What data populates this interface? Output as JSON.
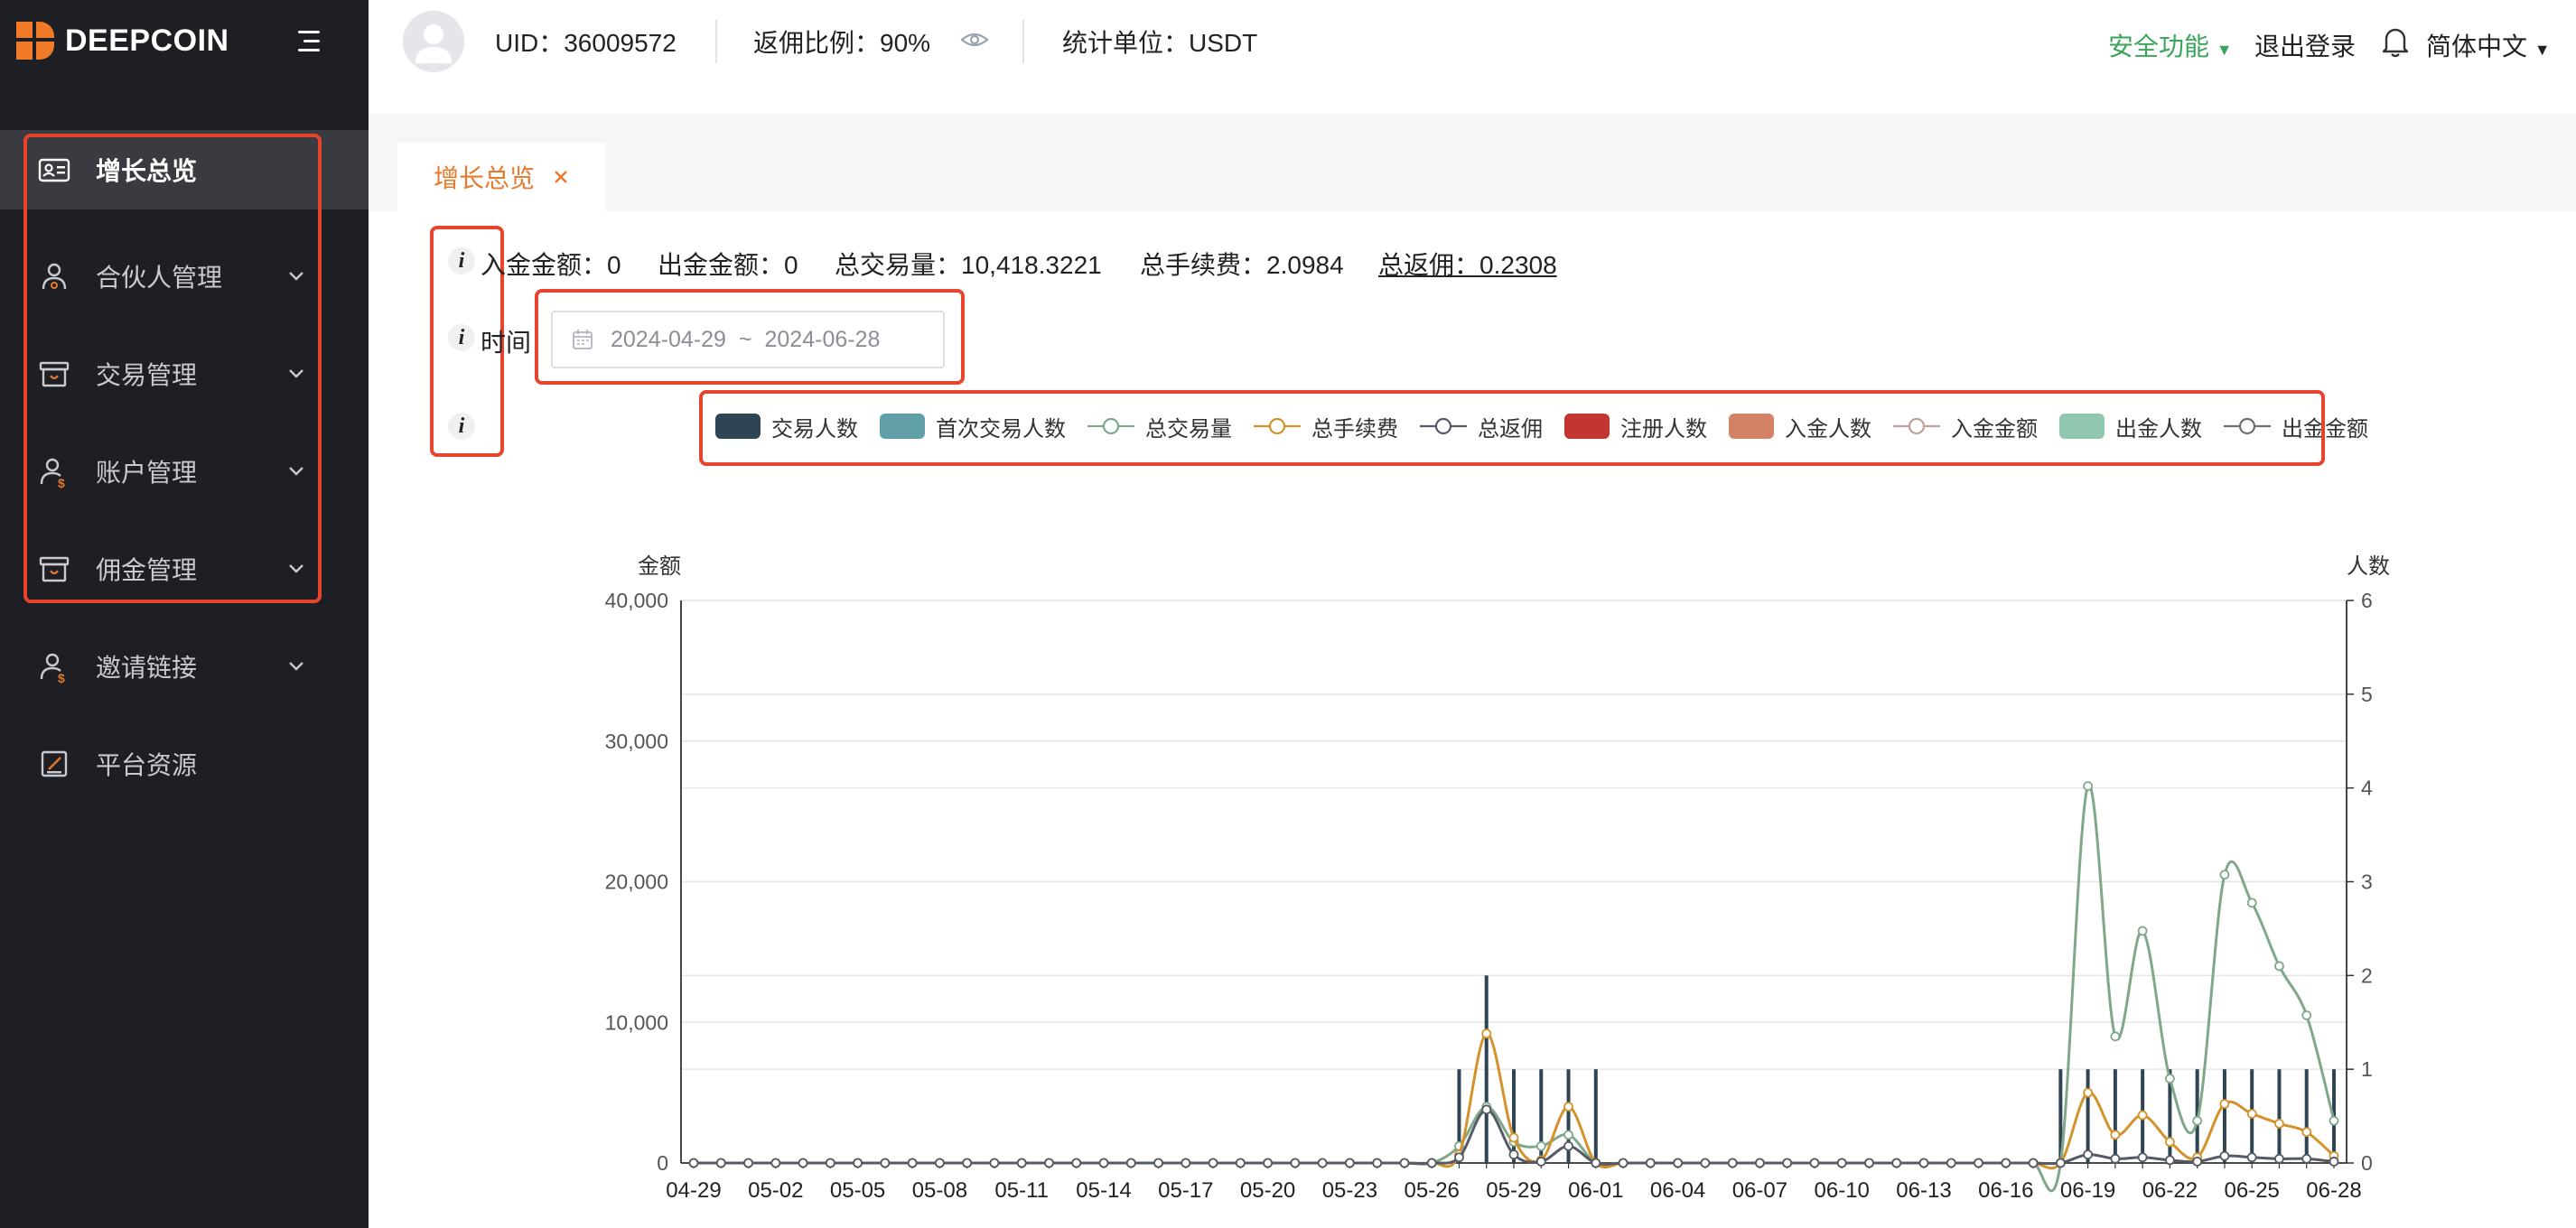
{
  "brand": {
    "name": "DEEPCOIN"
  },
  "sidebar": {
    "items": [
      {
        "label": "增长总览",
        "icon": "id-card-icon",
        "expandable": false,
        "active": true
      },
      {
        "label": "合伙人管理",
        "icon": "user-icon",
        "expandable": true
      },
      {
        "label": "交易管理",
        "icon": "box-icon",
        "expandable": true
      },
      {
        "label": "账户管理",
        "icon": "user-money-icon",
        "expandable": true
      },
      {
        "label": "佣金管理",
        "icon": "box-icon",
        "expandable": true
      },
      {
        "label": "邀请链接",
        "icon": "user-add-icon",
        "expandable": true
      },
      {
        "label": "平台资源",
        "icon": "edit-icon",
        "expandable": false
      }
    ]
  },
  "header": {
    "uid_label": "UID：",
    "uid": "36009572",
    "rebate_label": "返佣比例：",
    "rebate": "90%",
    "unit_label": "统计单位：",
    "unit": "USDT",
    "security": "安全功能",
    "logout": "退出登录",
    "language": "简体中文"
  },
  "tab": {
    "label": "增长总览"
  },
  "stats": [
    {
      "label": "入金金额：",
      "value": "0"
    },
    {
      "label": "出金金额：",
      "value": "0"
    },
    {
      "label": "总交易量：",
      "value": "10,418.3221"
    },
    {
      "label": "总手续费：",
      "value": "2.0984"
    },
    {
      "label": "总返佣：",
      "value": "0.2308"
    }
  ],
  "filter": {
    "time_label": "时间",
    "date_start": "2024-04-29",
    "date_sep": "~",
    "date_end": "2024-06-28"
  },
  "colors": {
    "accent_orange": "#e8782a",
    "security_green": "#3aa55a",
    "highlight_red": "#e8432c",
    "sidebar_bg": "#1e1f24"
  },
  "chart_data": {
    "type": "bar",
    "y_left_label": "金额",
    "y_right_label": "人数",
    "ylim_left": [
      0,
      40000
    ],
    "ylim_right": [
      0,
      6
    ],
    "yticks_left": [
      "0",
      "10,000",
      "20,000",
      "30,000",
      "40,000"
    ],
    "yticks_right": [
      "0",
      "1",
      "2",
      "3",
      "4",
      "5",
      "6"
    ],
    "xtick_labels": [
      "04-29",
      "05-02",
      "05-05",
      "05-08",
      "05-11",
      "05-14",
      "05-17",
      "05-20",
      "05-23",
      "05-26",
      "05-29",
      "06-01",
      "06-04",
      "06-07",
      "06-10",
      "06-13",
      "06-16",
      "06-19",
      "06-22",
      "06-25",
      "06-28"
    ],
    "x": [
      "04-29",
      "04-30",
      "05-01",
      "05-02",
      "05-03",
      "05-04",
      "05-05",
      "05-06",
      "05-07",
      "05-08",
      "05-09",
      "05-10",
      "05-11",
      "05-12",
      "05-13",
      "05-14",
      "05-15",
      "05-16",
      "05-17",
      "05-18",
      "05-19",
      "05-20",
      "05-21",
      "05-22",
      "05-23",
      "05-24",
      "05-25",
      "05-26",
      "05-27",
      "05-28",
      "05-29",
      "05-30",
      "05-31",
      "06-01",
      "06-02",
      "06-03",
      "06-04",
      "06-05",
      "06-06",
      "06-07",
      "06-08",
      "06-09",
      "06-10",
      "06-11",
      "06-12",
      "06-13",
      "06-14",
      "06-15",
      "06-16",
      "06-17",
      "06-18",
      "06-19",
      "06-20",
      "06-21",
      "06-22",
      "06-23",
      "06-24",
      "06-25",
      "06-26",
      "06-27",
      "06-28"
    ],
    "legend": [
      "交易人数",
      "首次交易人数",
      "总交易量",
      "总手续费",
      "总返佣",
      "注册人数",
      "入金人数",
      "入金金额",
      "出金人数",
      "出金金额"
    ],
    "series": [
      {
        "name": "交易人数",
        "kind": "bar",
        "axis": "right",
        "color": "#2f4554",
        "values": [
          0,
          0,
          0,
          0,
          0,
          0,
          0,
          0,
          0,
          0,
          0,
          0,
          0,
          0,
          0,
          0,
          0,
          0,
          0,
          0,
          0,
          0,
          0,
          0,
          0,
          0,
          0,
          0,
          1,
          2,
          1,
          1,
          1,
          1,
          0,
          0,
          0,
          0,
          0,
          0,
          0,
          0,
          0,
          0,
          0,
          0,
          0,
          0,
          0,
          0,
          1,
          1,
          1,
          1,
          1,
          1,
          1,
          1,
          1,
          1,
          1
        ]
      },
      {
        "name": "首次交易人数",
        "kind": "bar",
        "axis": "right",
        "color": "#61a0a8",
        "values": []
      },
      {
        "name": "总交易量",
        "kind": "line",
        "axis": "left",
        "color": "#7fa88a",
        "values": [
          0,
          0,
          0,
          0,
          0,
          0,
          0,
          0,
          0,
          0,
          0,
          0,
          0,
          0,
          0,
          0,
          0,
          0,
          0,
          0,
          0,
          0,
          0,
          0,
          0,
          0,
          0,
          0,
          1200,
          4000,
          1500,
          1200,
          2000,
          0,
          0,
          0,
          0,
          0,
          0,
          0,
          0,
          0,
          0,
          0,
          0,
          0,
          0,
          0,
          0,
          0,
          0,
          26800,
          9000,
          16500,
          6000,
          3000,
          20500,
          18500,
          14000,
          10500,
          3000
        ]
      },
      {
        "name": "总手续费",
        "kind": "line",
        "axis": "left",
        "color": "#d4922a",
        "values": [
          0,
          0,
          0,
          0,
          0,
          0,
          0,
          0,
          0,
          0,
          0,
          0,
          0,
          0,
          0,
          0,
          0,
          0,
          0,
          0,
          0,
          0,
          0,
          0,
          0,
          0,
          0,
          0,
          600,
          9200,
          1800,
          200,
          4000,
          0,
          0,
          0,
          0,
          0,
          0,
          0,
          0,
          0,
          0,
          0,
          0,
          0,
          0,
          0,
          0,
          0,
          0,
          5000,
          2000,
          3400,
          1500,
          400,
          4200,
          3500,
          2800,
          2200,
          500
        ]
      },
      {
        "name": "总返佣",
        "kind": "line",
        "axis": "left",
        "color": "#555a66",
        "values": [
          0,
          0,
          0,
          0,
          0,
          0,
          0,
          0,
          0,
          0,
          0,
          0,
          0,
          0,
          0,
          0,
          0,
          0,
          0,
          0,
          0,
          0,
          0,
          0,
          0,
          0,
          0,
          0,
          400,
          3800,
          600,
          100,
          1200,
          0,
          0,
          0,
          0,
          0,
          0,
          0,
          0,
          0,
          0,
          0,
          0,
          0,
          0,
          0,
          0,
          0,
          0,
          600,
          300,
          400,
          200,
          100,
          500,
          400,
          300,
          300,
          100
        ]
      },
      {
        "name": "注册人数",
        "kind": "bar",
        "axis": "right",
        "color": "#c23531",
        "values": []
      },
      {
        "name": "入金人数",
        "kind": "bar",
        "axis": "right",
        "color": "#d48265",
        "values": []
      },
      {
        "name": "入金金额",
        "kind": "line",
        "axis": "left",
        "color": "#bda29a",
        "values": []
      },
      {
        "name": "出金人数",
        "kind": "bar",
        "axis": "right",
        "color": "#91c7ae",
        "values": []
      },
      {
        "name": "出金金额",
        "kind": "line",
        "axis": "left",
        "color": "#6e7074",
        "values": []
      }
    ],
    "grid": true
  }
}
